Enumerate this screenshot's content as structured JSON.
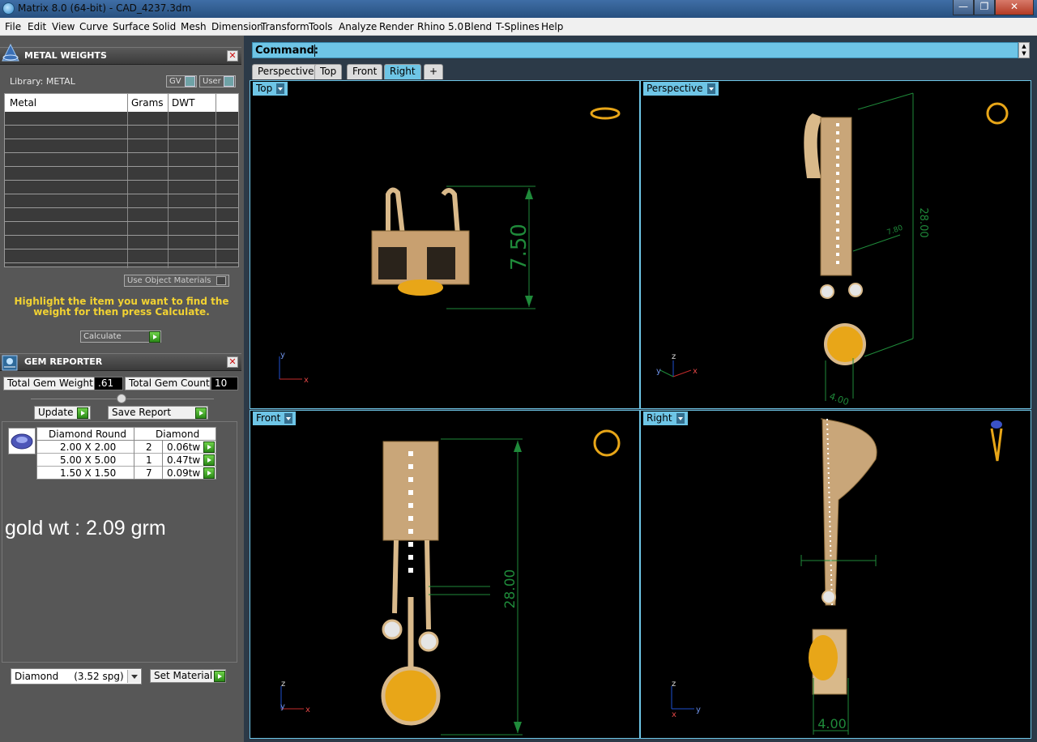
{
  "window": {
    "title": "Matrix 8.0 (64-bit) - CAD_4237.3dm",
    "min": "—",
    "max": "❐",
    "close": "✕"
  },
  "menu": [
    "File",
    "Edit",
    "View",
    "Curve",
    "Surface",
    "Solid",
    "Mesh",
    "Dimension",
    "Transform",
    "Tools",
    "Analyze",
    "Render",
    "Rhino 5.0",
    "Blend",
    "T-Splines",
    "Help"
  ],
  "metal_weights": {
    "title": "METAL WEIGHTS",
    "library_label": "Library: METAL",
    "gv": "GV",
    "user": "User",
    "columns": [
      "Metal",
      "Grams",
      "DWT"
    ],
    "use_object_materials": "Use Object Materials",
    "hint": "Highlight the item you want to find the weight for then press Calculate.",
    "calculate": "Calculate"
  },
  "gem_reporter": {
    "title": "GEM REPORTER",
    "total_weight_label": "Total Gem Weight",
    "total_weight": ".61",
    "total_count_label": "Total Gem Count",
    "total_count": "10",
    "update": "Update",
    "save_report": "Save Report",
    "col_shape": "Diamond Round",
    "col_material": "Diamond",
    "rows": [
      {
        "size": "2.00 X 2.00",
        "qty": "2",
        "wt": "0.06tw"
      },
      {
        "size": "5.00 X 5.00",
        "qty": "1",
        "wt": "0.47tw"
      },
      {
        "size": "1.50 X 1.50",
        "qty": "7",
        "wt": "0.09tw"
      }
    ],
    "note": "gold wt : 2.09 grm",
    "material": "Diamond     (3.52 spg)",
    "set_material": "Set Material"
  },
  "command": {
    "label": "Command:"
  },
  "view_tabs": [
    "Perspective",
    "Top",
    "Front",
    "Right",
    "+"
  ],
  "active_tab": "Right",
  "viewports": {
    "top": {
      "label": "Top",
      "dim": "7.50"
    },
    "perspective": {
      "label": "Perspective",
      "dim1": "28.00",
      "dim2": "7.80",
      "dim3": "4.00"
    },
    "front": {
      "label": "Front",
      "dim": "28.00"
    },
    "right": {
      "label": "Right",
      "dim": "4.00"
    }
  },
  "colors": {
    "accent": "#6ec5e6",
    "gold": "#d9b98a",
    "gem": "#e8a618",
    "dim": "#1f8a3a"
  }
}
